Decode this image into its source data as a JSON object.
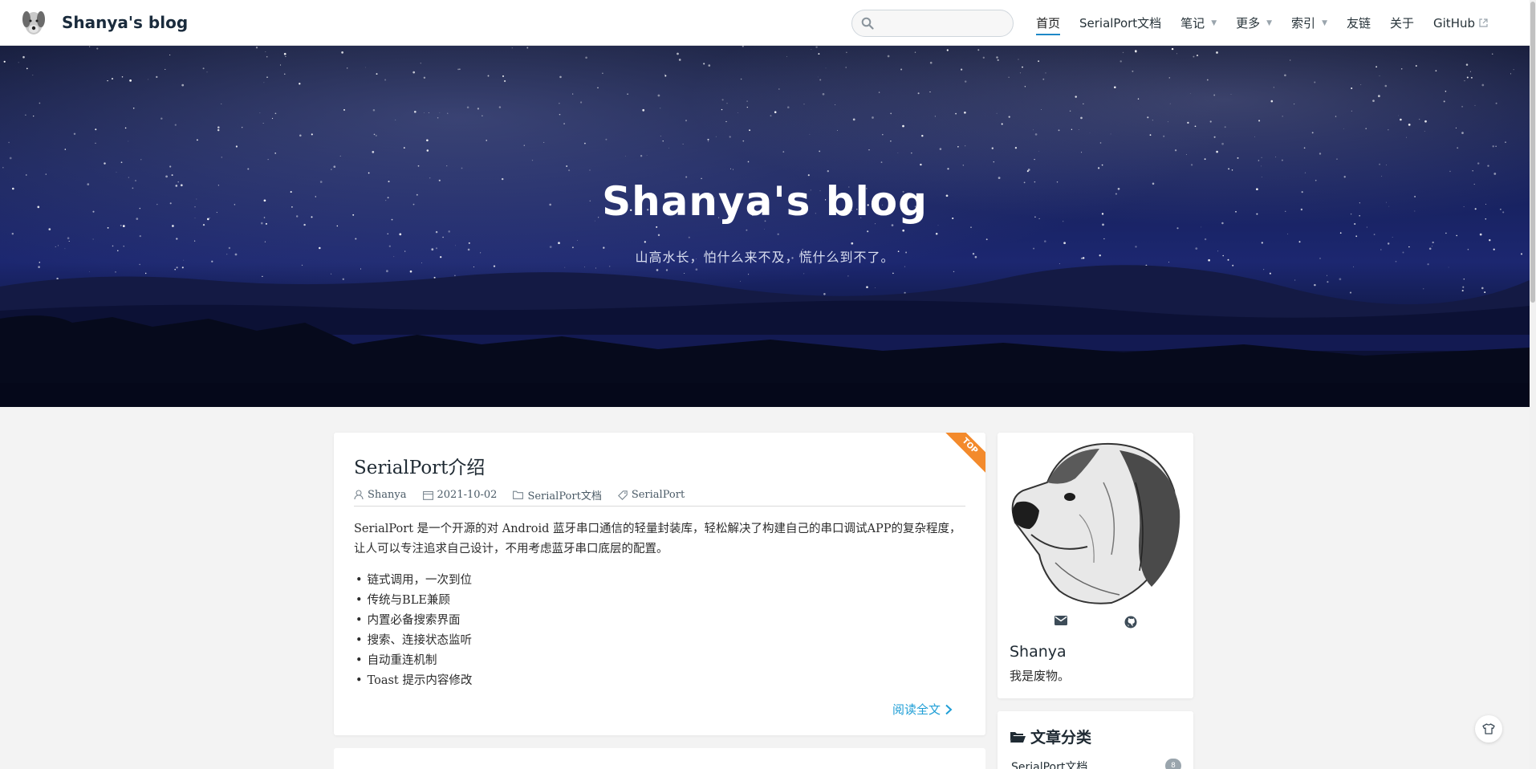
{
  "header": {
    "site_title": "Shanya's blog",
    "search": {
      "value": "",
      "placeholder": ""
    },
    "nav": [
      {
        "label": "首页",
        "active": true,
        "caret": false,
        "external": false
      },
      {
        "label": "SerialPort文档",
        "active": false,
        "caret": false,
        "external": false
      },
      {
        "label": "笔记",
        "active": false,
        "caret": true,
        "external": false
      },
      {
        "label": "更多",
        "active": false,
        "caret": true,
        "external": false
      },
      {
        "label": "索引",
        "active": false,
        "caret": true,
        "external": false
      },
      {
        "label": "友链",
        "active": false,
        "caret": false,
        "external": false
      },
      {
        "label": "关于",
        "active": false,
        "caret": false,
        "external": false
      },
      {
        "label": "GitHub",
        "active": false,
        "caret": false,
        "external": true
      }
    ]
  },
  "hero": {
    "title": "Shanya's blog",
    "subtitle": "山高水长，怕什么来不及，慌什么到不了。"
  },
  "post": {
    "badge": "TOP",
    "title": "SerialPort介绍",
    "author": "Shanya",
    "date": "2021-10-02",
    "category": "SerialPort文档",
    "tag": "SerialPort",
    "excerpt": "SerialPort 是一个开源的对 Android 蓝牙串口通信的轻量封装库，轻松解决了构建自己的串口调试APP的复杂程度，让人可以专注追求自己设计，不用考虑蓝牙串口底层的配置。",
    "features": [
      "链式调用，一次到位",
      "传统与BLE兼顾",
      "内置必备搜索界面",
      "搜索、连接状态监听",
      "自动重连机制",
      "Toast 提示内容修改"
    ],
    "read_more": "阅读全文"
  },
  "profile": {
    "name": "Shanya",
    "bio": "我是废物。",
    "social_icons": [
      "mail-icon",
      "github-icon"
    ]
  },
  "categories": {
    "title": "文章分类",
    "items": [
      {
        "label": "SerialPort文档",
        "count": "8"
      }
    ]
  },
  "colors": {
    "accent": "#1e88c7",
    "link": "#1e9ed6",
    "top_badge": "#f38a2c",
    "page_bg": "#f3f3f3"
  }
}
